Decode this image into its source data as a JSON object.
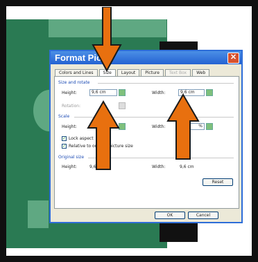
{
  "dialog": {
    "title": "Format Pic",
    "close_label": "✕",
    "tabs": [
      {
        "label": "Colors and Lines"
      },
      {
        "label": "Size"
      },
      {
        "label": "Layout"
      },
      {
        "label": "Picture"
      },
      {
        "label": "Text Box"
      },
      {
        "label": "Web"
      }
    ],
    "size_rotate": {
      "header": "Size and rotate",
      "height_label": "Height:",
      "height_value": "9,6 cm",
      "width_label": "Width:",
      "width_value": "9,6 cm",
      "rotation_label": "Rotation:"
    },
    "scale": {
      "header": "Scale",
      "height_label": "Height:",
      "width_label": "Width:",
      "width_value": "%",
      "lock_label": "Lock aspect",
      "relative_label": "Relative to original picture size"
    },
    "original": {
      "header": "Original size",
      "height_label": "Height:",
      "height_value": "9,6 cm",
      "width_label": "Width:",
      "width_value": "9,6 cm"
    },
    "buttons": {
      "reset": "Reset",
      "ok": "OK",
      "cancel": "Cancel"
    }
  },
  "colors": {
    "arrow": "#e8700f",
    "green": "#2a7a53",
    "title_bar": "#2462d2"
  }
}
